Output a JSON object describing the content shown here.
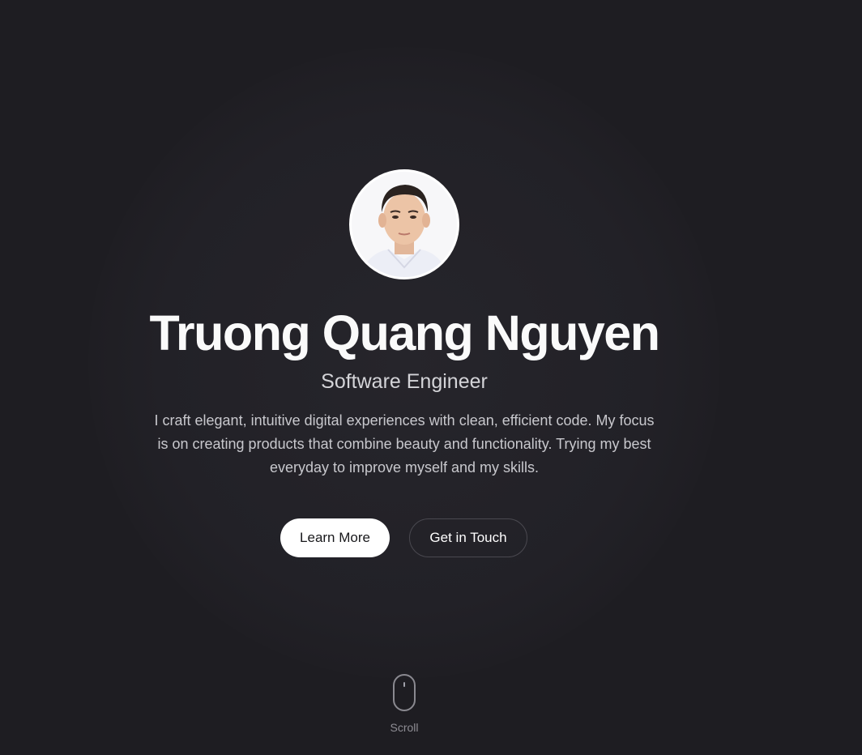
{
  "profile": {
    "name": "Truong Quang Nguyen",
    "role": "Software Engineer",
    "bio": "I craft elegant, intuitive digital experiences with clean, efficient code. My focus is on creating products that combine beauty and functionality. Trying my best everyday to improve myself and my skills.",
    "avatar_icon": "profile-photo"
  },
  "actions": {
    "primary_label": "Learn More",
    "secondary_label": "Get in Touch"
  },
  "scroll": {
    "label": "Scroll",
    "icon": "mouse-icon"
  },
  "colors": {
    "background": "#1e1d22",
    "primary_button_bg": "#ffffff",
    "text": "#fafafa"
  }
}
